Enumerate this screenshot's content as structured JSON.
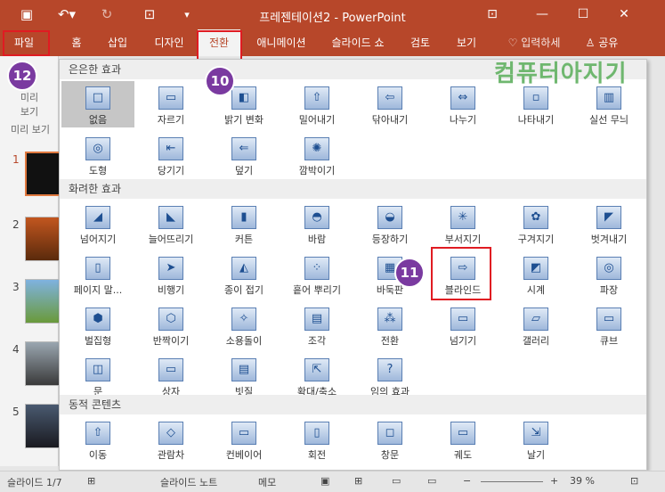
{
  "window": {
    "title": "프레젠테이션2 - PowerPoint",
    "icons": {
      "save": "save-icon",
      "undo": "undo-icon",
      "redo": "redo-icon",
      "present": "slideshow-icon",
      "customize": "qat-dropdown-icon"
    }
  },
  "tabs": [
    {
      "label": "파일"
    },
    {
      "label": "홈"
    },
    {
      "label": "삽입"
    },
    {
      "label": "디자인"
    },
    {
      "label": "전환"
    },
    {
      "label": "애니메이션"
    },
    {
      "label": "슬라이드 쇼"
    },
    {
      "label": "검토"
    },
    {
      "label": "보기"
    },
    {
      "label": "입력하세"
    },
    {
      "label": "공유"
    }
  ],
  "annotations": {
    "a": "10",
    "b": "11",
    "c": "12"
  },
  "logo_text": "컴퓨터아지기",
  "left": {
    "preview_top": "미리",
    "preview_bottom": "보기",
    "preview_section": "미리 보기",
    "slides": [
      "1",
      "2",
      "3",
      "4",
      "5"
    ]
  },
  "gallery": {
    "sections": [
      "은은한 효과",
      "화려한 효과",
      "동적 콘텐츠"
    ],
    "subtle": [
      "없음",
      "자르기",
      "밝기 변화",
      "밀어내기",
      "닦아내기",
      "나누기",
      "나타내기",
      "실선 무늬",
      "도형",
      "당기기",
      "덮기",
      "깜박이기"
    ],
    "exciting": [
      "넘어지기",
      "늘어뜨리기",
      "커튼",
      "바람",
      "등장하기",
      "부서지기",
      "구겨지기",
      "벗겨내기",
      "페이지 말...",
      "비행기",
      "종이 접기",
      "흩어 뿌리기",
      "바둑판",
      "블라인드",
      "시계",
      "파장",
      "벌집형",
      "반짝이기",
      "소용돌이",
      "조각",
      "전환",
      "넘기기",
      "갤러리",
      "큐브",
      "문",
      "상자",
      "빗질",
      "확대/축소",
      "임의 효과"
    ],
    "dynamic": [
      "이동",
      "관람차",
      "컨베이어",
      "회전",
      "창문",
      "궤도",
      "날기"
    ]
  },
  "status": {
    "slide_count": "슬라이드 1/7",
    "notes": "슬라이드 노트",
    "comments": "메모",
    "zoom": "39 %"
  }
}
